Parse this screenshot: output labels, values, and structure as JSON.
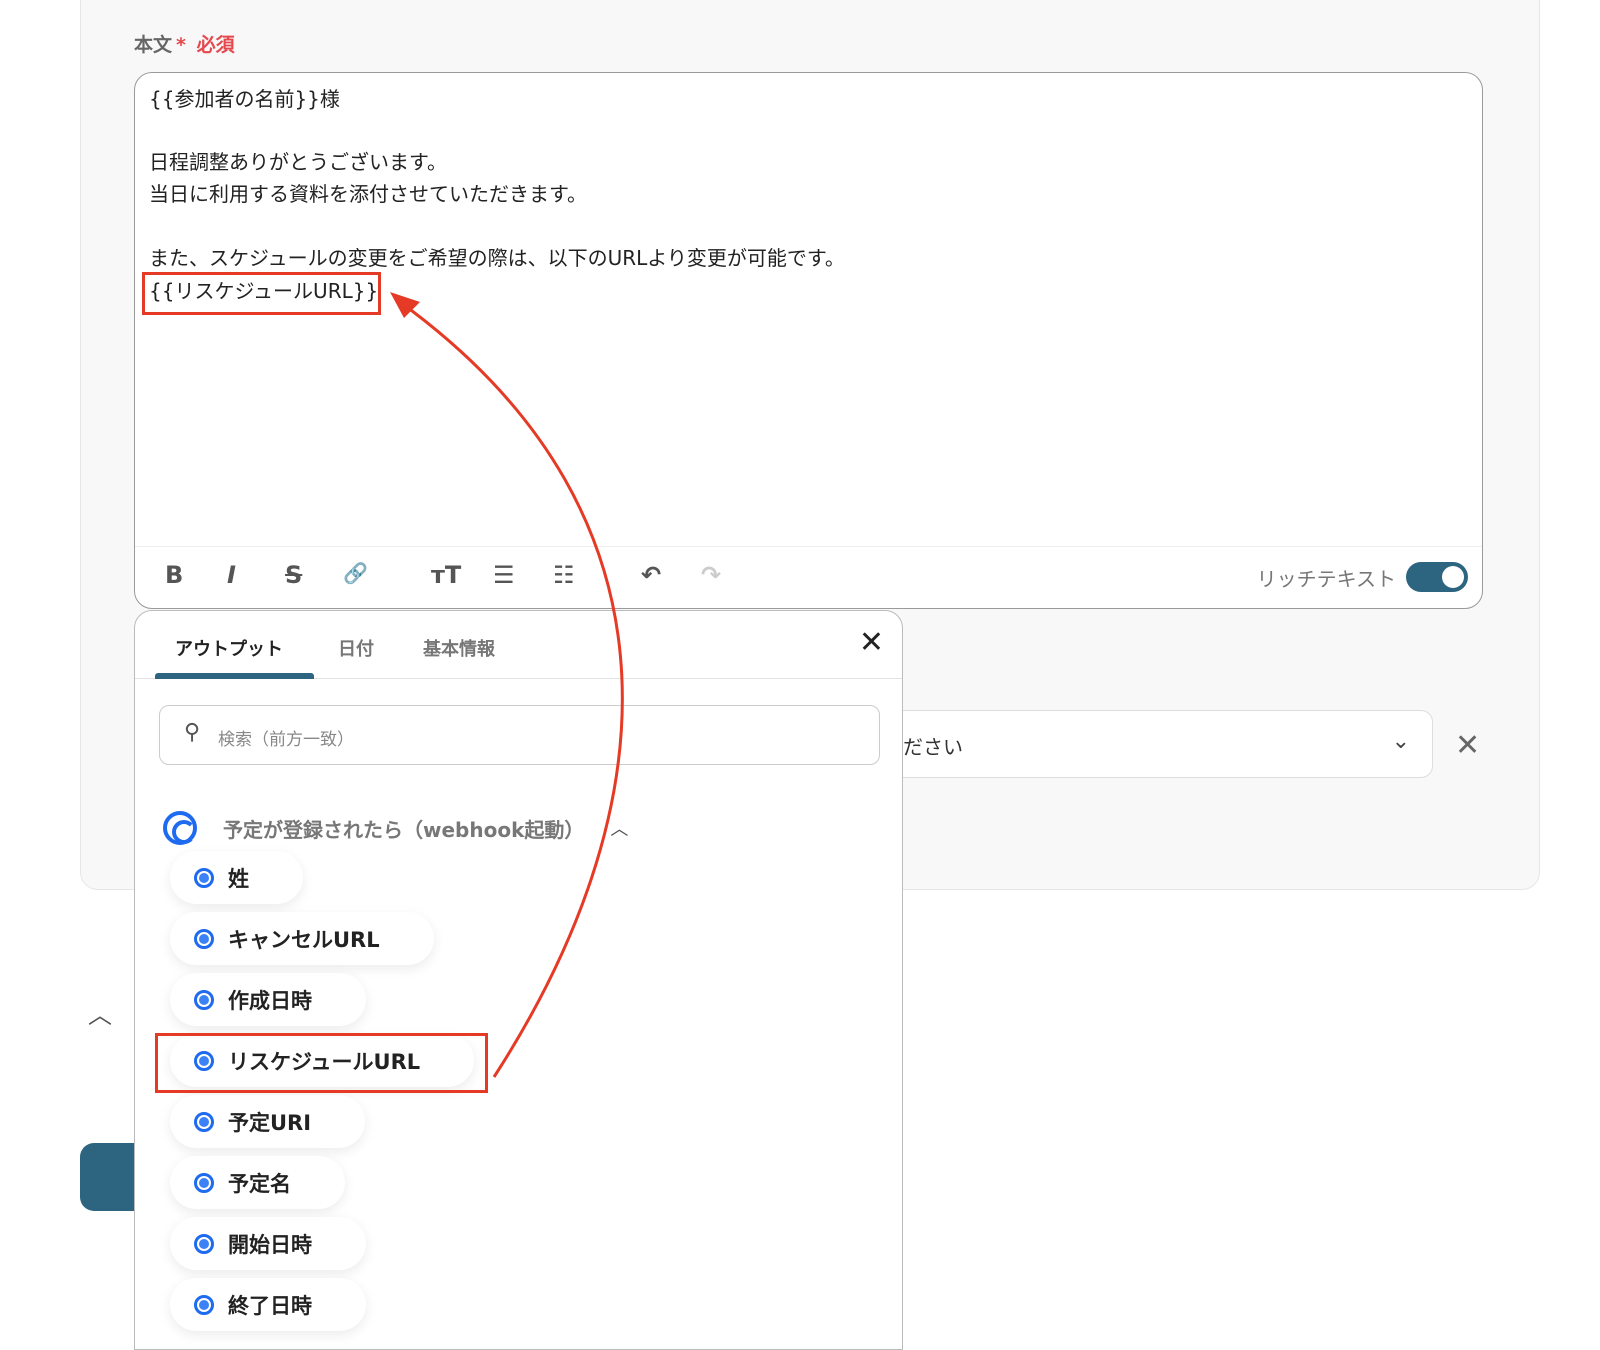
{
  "field": {
    "label": "本文",
    "required_mark": "*",
    "required_text": "必須"
  },
  "editor": {
    "lines": [
      "{{参加者の名前}}様",
      "日程調整ありがとうございます。",
      "当日に利用する資料を添付させていただきます。",
      "また、スケジュールの変更をご希望の際は、以下のURLより変更が可能です。",
      "{{リスケジュールURL}}"
    ]
  },
  "toolbar": {
    "bold": "B",
    "italic": "I",
    "strike": "S",
    "link": "🔗",
    "textsize": "ᴛT",
    "bullets": "☰",
    "numbered": "☷",
    "undo": "↶",
    "redo": "↷",
    "rich_text_label": "リッチテキスト",
    "rich_text_on": true
  },
  "select": {
    "placeholder_fragment": "ださい"
  },
  "panel": {
    "tabs": [
      "アウトプット",
      "日付",
      "基本情報"
    ],
    "active_tab": 0,
    "search_placeholder": "検索（前方一致）",
    "group_title": "予定が登録されたら（webhook起動）",
    "items": [
      "姓",
      "キャンセルURL",
      "作成日時",
      "リスケジュールURL",
      "予定URI",
      "予定名",
      "開始日時",
      "終了日時"
    ]
  },
  "annotation_color": "#e53a25"
}
